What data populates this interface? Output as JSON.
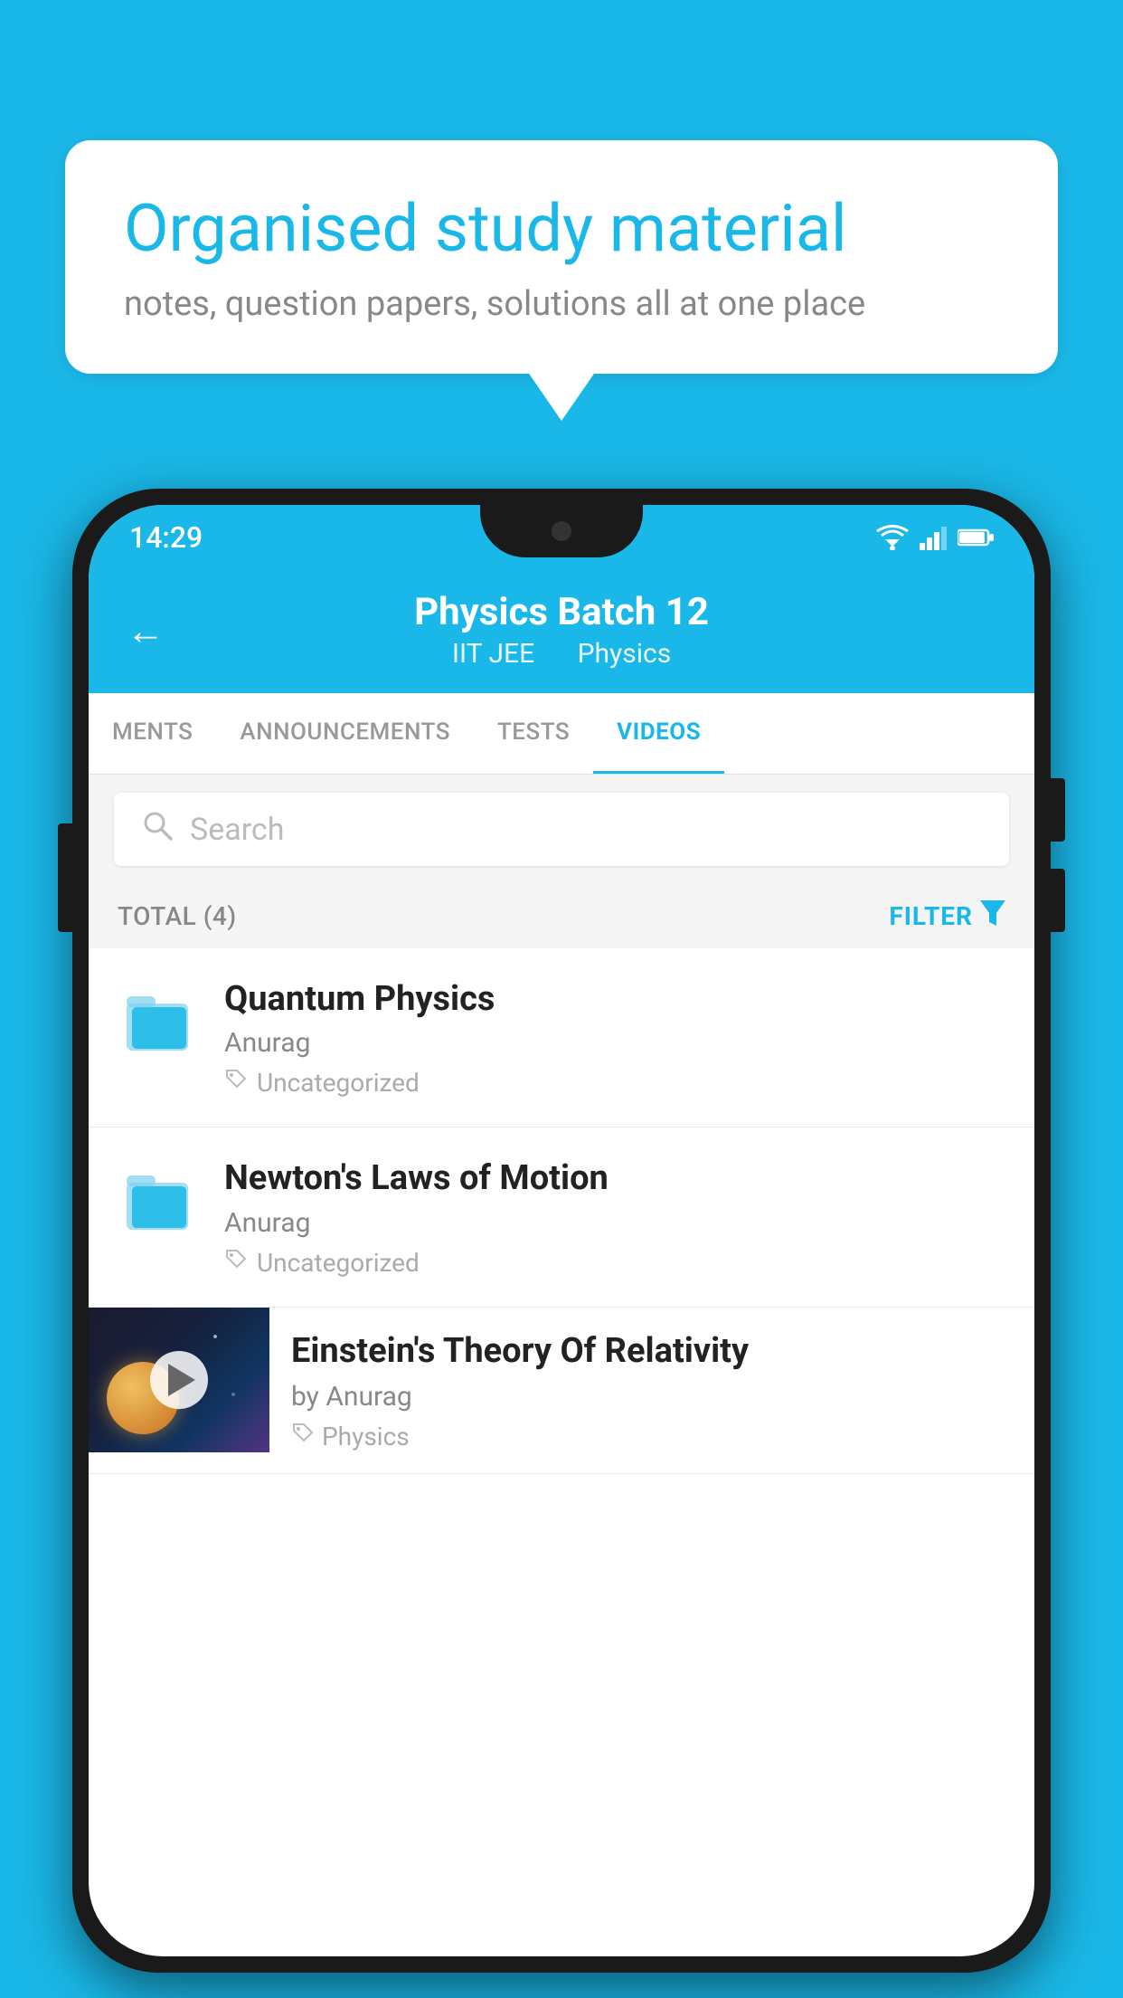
{
  "background_color": "#1ab8e8",
  "speech_bubble": {
    "title": "Organised study material",
    "subtitle": "notes, question papers, solutions all at one place"
  },
  "status_bar": {
    "time": "14:29"
  },
  "app_header": {
    "title": "Physics Batch 12",
    "tag1": "IIT JEE",
    "tag2": "Physics",
    "back_label": "←"
  },
  "tabs": [
    {
      "label": "MENTS",
      "active": false
    },
    {
      "label": "ANNOUNCEMENTS",
      "active": false
    },
    {
      "label": "TESTS",
      "active": false
    },
    {
      "label": "VIDEOS",
      "active": true
    }
  ],
  "search": {
    "placeholder": "Search"
  },
  "filter": {
    "total_label": "TOTAL (4)",
    "button_label": "FILTER"
  },
  "list_items": [
    {
      "title": "Quantum Physics",
      "author": "Anurag",
      "tag": "Uncategorized",
      "type": "folder"
    },
    {
      "title": "Newton's Laws of Motion",
      "author": "Anurag",
      "tag": "Uncategorized",
      "type": "folder"
    },
    {
      "title": "Einstein's Theory Of Relativity",
      "author": "by Anurag",
      "tag": "Physics",
      "type": "video"
    }
  ]
}
